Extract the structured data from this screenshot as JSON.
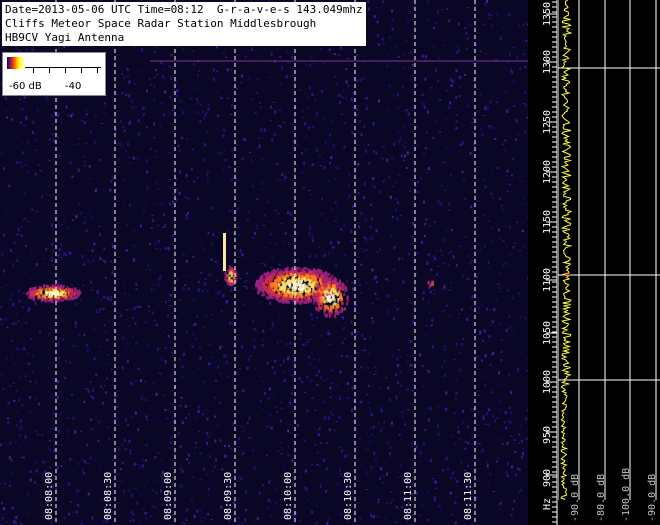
{
  "header": {
    "line1": "Date=2013-05-06 UTC Time=08:12  G-r-a-v-e-s 143.049mhz",
    "line2": "Cliffs Meteor Space Radar Station Middlesbrough",
    "line3": "HB9CV Yagi Antenna"
  },
  "legend": {
    "low_label": "-60 dB",
    "high_label": "-40"
  },
  "time_axis": {
    "labels": [
      "08:08:00",
      "08:08:30",
      "08:09:00",
      "08:09:30",
      "08:10:00",
      "08:10:30",
      "08:11:00",
      "08:11:30"
    ]
  },
  "freq_axis": {
    "labels": [
      "1350",
      "1300",
      "1250",
      "1200",
      "1150",
      "1100",
      "1050",
      "1000",
      "950",
      "900"
    ],
    "unit": "Hz"
  },
  "psd_axis": {
    "labels": [
      "-90.0 dB",
      "-80.0 dB",
      "-100.0 dB",
      "-90.0 dB"
    ]
  },
  "colors": {
    "background": "#0a0626",
    "grid": "#ffffff",
    "trace": "#ffff40",
    "echo_hot": "#fff5c0"
  }
}
